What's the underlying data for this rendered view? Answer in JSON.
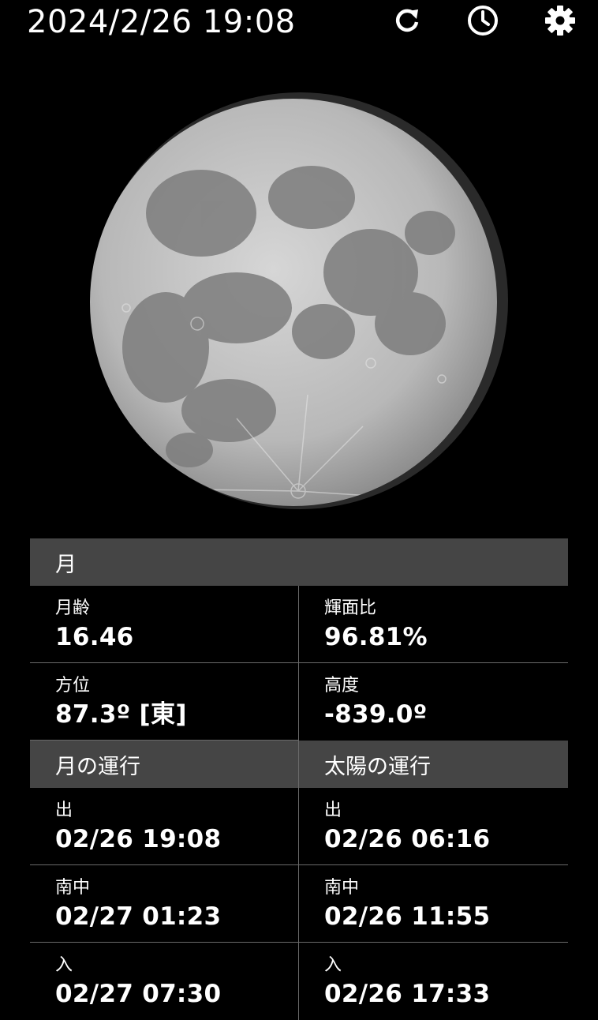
{
  "header": {
    "datetime": "2024/2/26 19:08"
  },
  "moon_section": {
    "title": "月",
    "age_label": "月齢",
    "age_value": "16.46",
    "illumination_label": "輝面比",
    "illumination_value": "96.81%",
    "azimuth_label": "方位",
    "azimuth_value": "87.3º [東]",
    "altitude_label": "高度",
    "altitude_value": "-839.0º"
  },
  "transit": {
    "moon_title": "月の運行",
    "sun_title": "太陽の運行",
    "rise_label": "出",
    "culmination_label": "南中",
    "set_label": "入",
    "moon_rise": "02/26 19:08",
    "moon_culmination": "02/27 01:23",
    "moon_set": "02/27 07:30",
    "sun_rise": "02/26 06:16",
    "sun_culmination": "02/26 11:55",
    "sun_set": "02/26 17:33"
  },
  "moon_phase": {
    "illuminated_fraction": 0.9681
  },
  "icons": {
    "refresh": "refresh-icon",
    "history": "clock-icon",
    "settings": "gear-icon"
  }
}
